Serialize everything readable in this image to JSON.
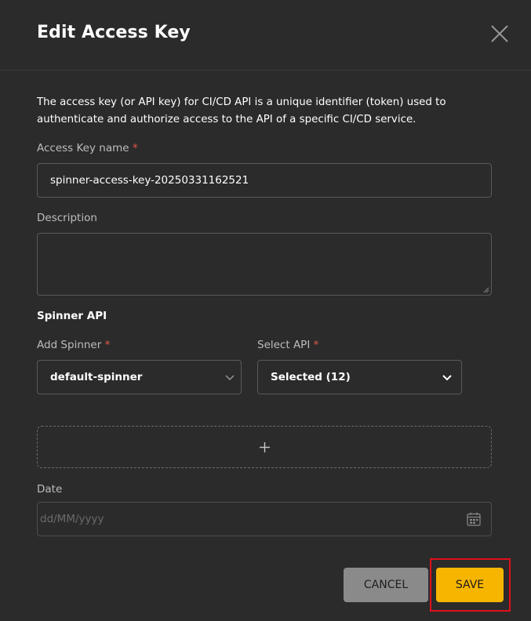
{
  "dialog": {
    "title": "Edit Access Key",
    "intro": "The access key (or API key) for CI/CD API is a unique identifier (token) used to authenticate and authorize access to the API of a specific CI/CD service."
  },
  "form": {
    "name_label": "Access Key name",
    "required_mark": "*",
    "name_value": "spinner-access-key-20250331162521",
    "description_label": "Description",
    "description_value": "",
    "section_title": "Spinner API",
    "spinner_label": "Add Spinner",
    "spinner_value": "default-spinner",
    "api_label": "Select API",
    "api_value": "Selected (12)",
    "add_symbol": "+",
    "date_label": "Date",
    "date_placeholder": "dd/MM/yyyy"
  },
  "actions": {
    "cancel_label": "CANCEL",
    "save_label": "SAVE"
  },
  "icons": {
    "close": "close-icon",
    "chevron": "chevron-down-icon",
    "plus": "plus-icon",
    "calendar": "calendar-icon"
  },
  "colors": {
    "background": "#2b2b2b",
    "accent": "#f7b500",
    "required": "#e2574c",
    "cancel": "#8a8a8a",
    "highlight": "#e0101a"
  }
}
